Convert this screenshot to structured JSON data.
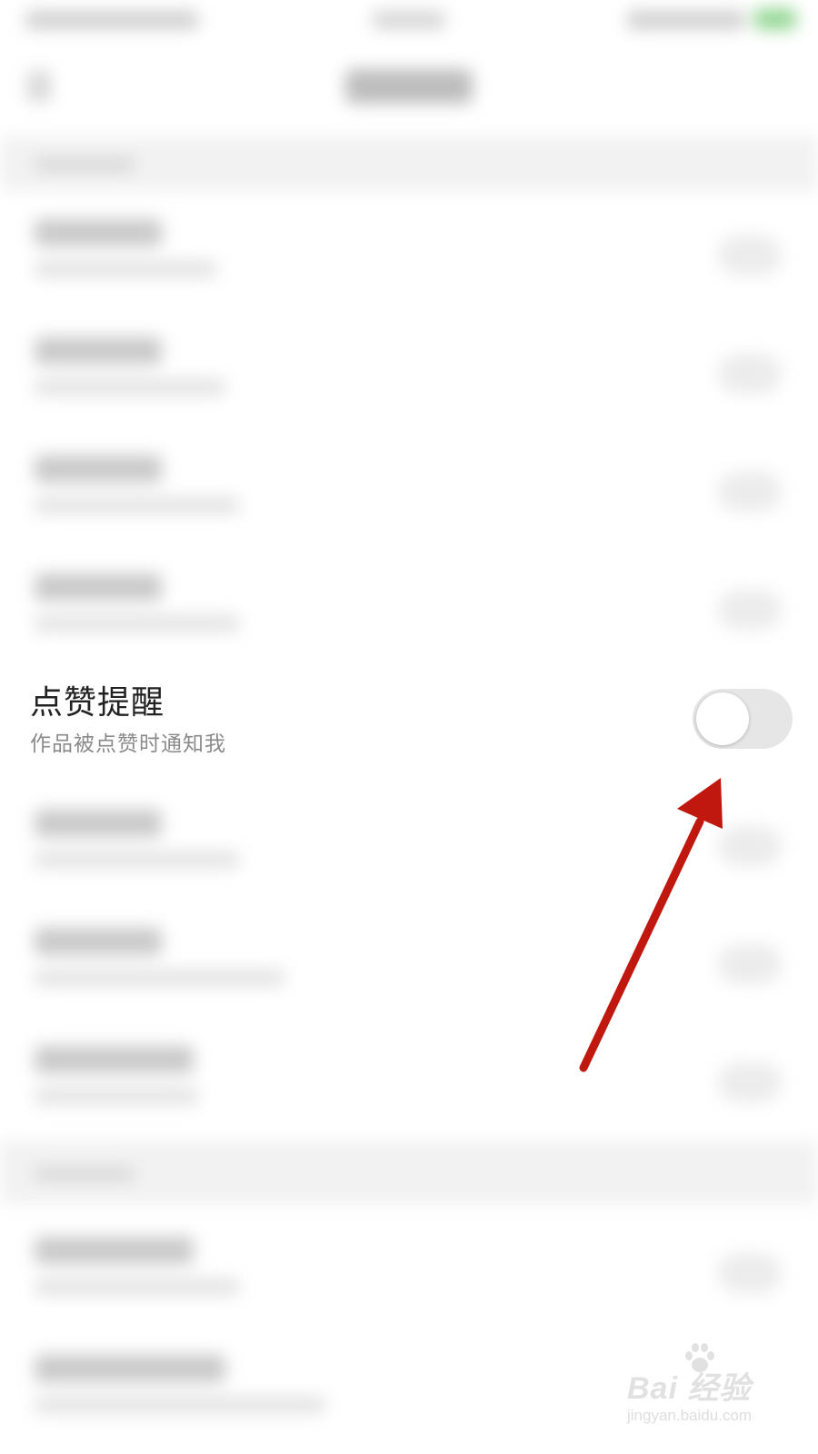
{
  "setting": {
    "title": "点赞提醒",
    "subtitle": "作品被点赞时通知我",
    "toggle_on": false,
    "toggle_off_color": "#e6e6e6",
    "knob_color": "#ffffff"
  },
  "annotation": {
    "arrow_color": "#c0170f",
    "arrow_target": "like-reminder-toggle"
  },
  "watermark": {
    "main": "Bai  经验",
    "sub": "jingyan.baidu.com"
  },
  "icons": {
    "paw": "baidu-paw-icon",
    "arrow": "red-arrow-icon"
  }
}
